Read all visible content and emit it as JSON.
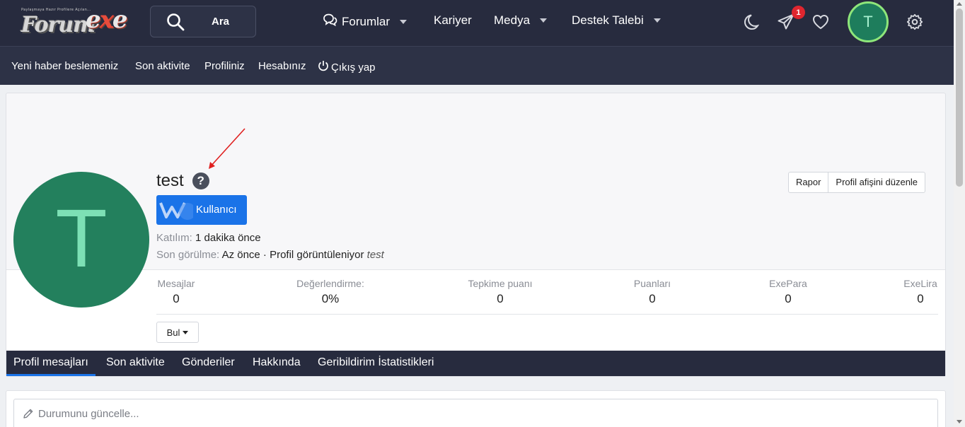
{
  "logo": {
    "tagline": "Paylaşmaya Hazır Profilere Açılan...",
    "word": "Forum",
    "exe_pre": "e",
    "exe_x": "x",
    "exe_post": "e"
  },
  "search": {
    "label": "Ara"
  },
  "nav": {
    "forums": "Forumlar",
    "career": "Kariyer",
    "media": "Medya",
    "support": "Destek Talebi"
  },
  "top_icons": {
    "notif_count": "1",
    "user_initial": "T"
  },
  "subnav": {
    "items": [
      "Yeni haber beslemeniz",
      "Son aktivite",
      "Profiliniz",
      "Hesabınız"
    ],
    "logout": "Çıkış yap"
  },
  "profile": {
    "initial": "T",
    "username": "test",
    "role": "Kullanıcı",
    "joined_label": "Katılım:",
    "joined_value": "1 dakika önce",
    "lastseen_label": "Son görülme:",
    "lastseen_value": "Az önce · Profil görüntüleniyor",
    "lastseen_user": "test",
    "report_button": "Rapor",
    "edit_banner_button": "Profil afişini düzenle",
    "find_button": "Bul"
  },
  "stats": [
    {
      "label": "Mesajlar",
      "value": "0"
    },
    {
      "label": "Değerlendirme:",
      "value": "0%"
    },
    {
      "label": "Tepkime puanı",
      "value": "0"
    },
    {
      "label": "Puanları",
      "value": "0"
    },
    {
      "label": "ExePara",
      "value": "0"
    },
    {
      "label": "ExeLira",
      "value": "0"
    }
  ],
  "tabs": [
    "Profil mesajları",
    "Son aktivite",
    "Gönderiler",
    "Hakkında",
    "Geribildirim İstatistikleri"
  ],
  "status": {
    "placeholder": "Durumunu güncelle..."
  },
  "colors": {
    "navbar": "#272b3e",
    "accent": "#1a73e8",
    "avatar": "#23805d",
    "badge": "#e0262f"
  }
}
